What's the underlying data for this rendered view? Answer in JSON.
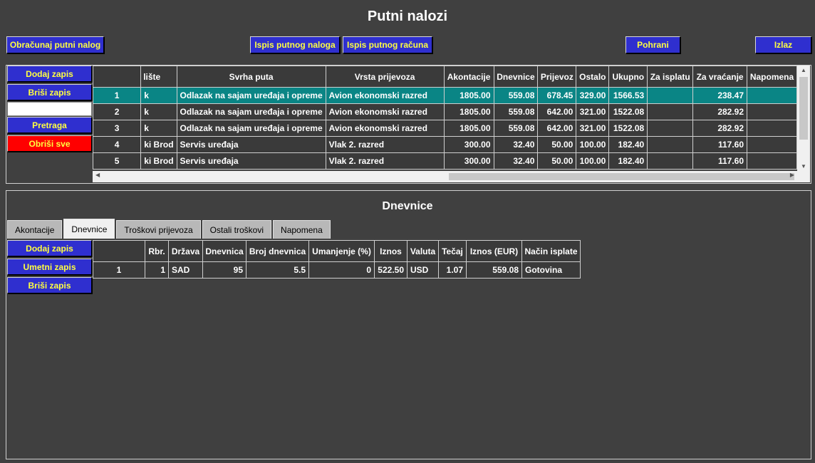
{
  "window": {
    "title": "Putni nalozi"
  },
  "toolbar": {
    "calculate": "Obračunaj putni nalog",
    "print_order": "Ispis putnog naloga",
    "print_invoice": "Ispis putnog računa",
    "save": "Pohrani",
    "exit": "Izlaz"
  },
  "left_actions": {
    "add": "Dodaj zapis",
    "delete": "Briši zapis",
    "search": "Pretraga",
    "delete_all": "Obriši sve"
  },
  "orders": {
    "columns": [
      "",
      "lište",
      "Svrha puta",
      "Vrsta prijevoza",
      "Akontacije",
      "Dnevnice",
      "Prijevoz",
      "Ostalo",
      "Ukupno",
      "Za isplatu",
      "Za vraćanje",
      "Napomena"
    ],
    "rows": [
      [
        "1",
        "k",
        "Odlazak na sajam uređaja i opreme",
        "Avion ekonomski razred",
        "1805.00",
        "559.08",
        "678.45",
        "329.00",
        "1566.53",
        "",
        "238.47",
        ""
      ],
      [
        "2",
        "k",
        "Odlazak na sajam uređaja i opreme",
        "Avion ekonomski razred",
        "1805.00",
        "559.08",
        "642.00",
        "321.00",
        "1522.08",
        "",
        "282.92",
        ""
      ],
      [
        "3",
        "k",
        "Odlazak na sajam uređaja i opreme",
        "Avion ekonomski razred",
        "1805.00",
        "559.08",
        "642.00",
        "321.00",
        "1522.08",
        "",
        "282.92",
        ""
      ],
      [
        "4",
        "ki Brod",
        "Servis uređaja",
        "Vlak 2. razred",
        "300.00",
        "32.40",
        "50.00",
        "100.00",
        "182.40",
        "",
        "117.60",
        ""
      ],
      [
        "5",
        "ki Brod",
        "Servis uređaja",
        "Vlak 2. razred",
        "300.00",
        "32.40",
        "50.00",
        "100.00",
        "182.40",
        "",
        "117.60",
        ""
      ]
    ],
    "selected_row": 0
  },
  "details": {
    "title": "Dnevnice",
    "tabs": [
      "Akontacije",
      "Dnevnice",
      "Troškovi prijevoza",
      "Ostali troškovi",
      "Napomena"
    ],
    "active_tab": 1,
    "actions": {
      "add": "Dodaj zapis",
      "insert": "Umetni zapis",
      "delete": "Briši zapis"
    },
    "columns": [
      "",
      "Rbr.",
      "Država",
      "Dnevnica",
      "Broj dnevnica",
      "Umanjenje (%)",
      "Iznos",
      "Valuta",
      "Tečaj",
      "Iznos (EUR)",
      "Način isplate"
    ],
    "rows": [
      [
        "1",
        "1",
        "SAD",
        "95",
        "5.5",
        "0",
        "522.50",
        "USD",
        "1.07",
        "559.08",
        "Gotovina"
      ]
    ]
  },
  "colors": {
    "button_bg": "#2f2fcf",
    "button_text": "#ffff40",
    "danger": "#ff0000",
    "selection": "#0a8585",
    "background": "#404040"
  }
}
